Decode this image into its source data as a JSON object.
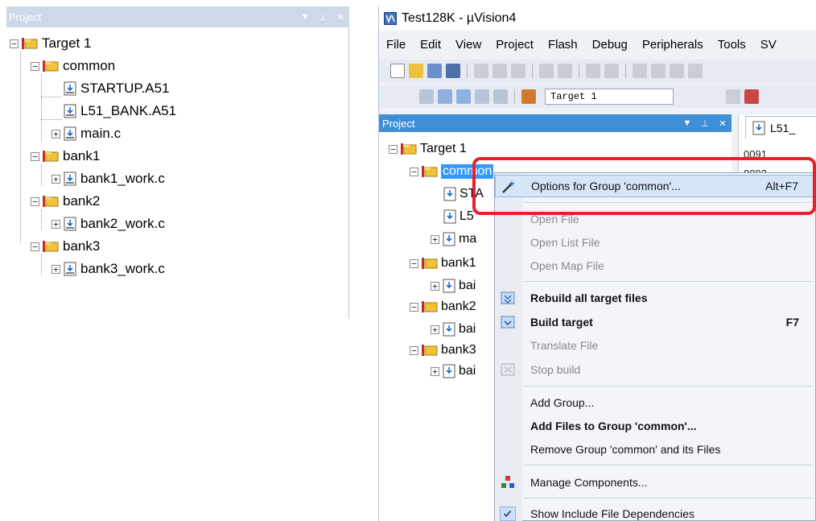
{
  "left_pane": {
    "title": "Project",
    "tree": {
      "root": "Target 1",
      "common": "common",
      "startup": "STARTUP.A51",
      "l51bank": "L51_BANK.A51",
      "mainc": "main.c",
      "bank1": "bank1",
      "bank1work": "bank1_work.c",
      "bank2": "bank2",
      "bank2work": "bank2_work.c",
      "bank3": "bank3",
      "bank3work": "bank3_work.c"
    },
    "expander_minus": "−",
    "expander_plus": "+"
  },
  "window": {
    "title": "Test128K - µVision4",
    "menu": [
      "File",
      "Edit",
      "View",
      "Project",
      "Flash",
      "Debug",
      "Peripherals",
      "Tools",
      "SV"
    ],
    "target_select": "Target 1",
    "project_panel_title": "Project",
    "editor_tab": "L51_",
    "line_numbers": [
      "0091",
      "0092"
    ],
    "tree": {
      "root": "Target 1",
      "common": "common",
      "st": "STA",
      "l5": "L5",
      "ma": "ma",
      "bank1": "bank1",
      "ba1": "bai",
      "bank2": "bank2",
      "ba2": "bai",
      "bank3": "bank3",
      "ba3": "bai"
    }
  },
  "context_menu": {
    "options": "Options for Group 'common'...",
    "options_shortcut": "Alt+F7",
    "open_file": "Open File",
    "open_list_file": "Open List File",
    "open_map_file": "Open Map File",
    "rebuild": "Rebuild all target files",
    "build": "Build target",
    "build_shortcut": "F7",
    "translate": "Translate File",
    "stop_build": "Stop build",
    "add_group": "Add Group...",
    "add_files": "Add Files to Group 'common'...",
    "remove_group": "Remove Group 'common' and its Files",
    "manage_components": "Manage Components...",
    "show_include": "Show Include File Dependencies"
  },
  "colors": {
    "panel_header": "#3f8fd6",
    "selection": "#3399ff",
    "highlight_box": "#e8202a"
  }
}
